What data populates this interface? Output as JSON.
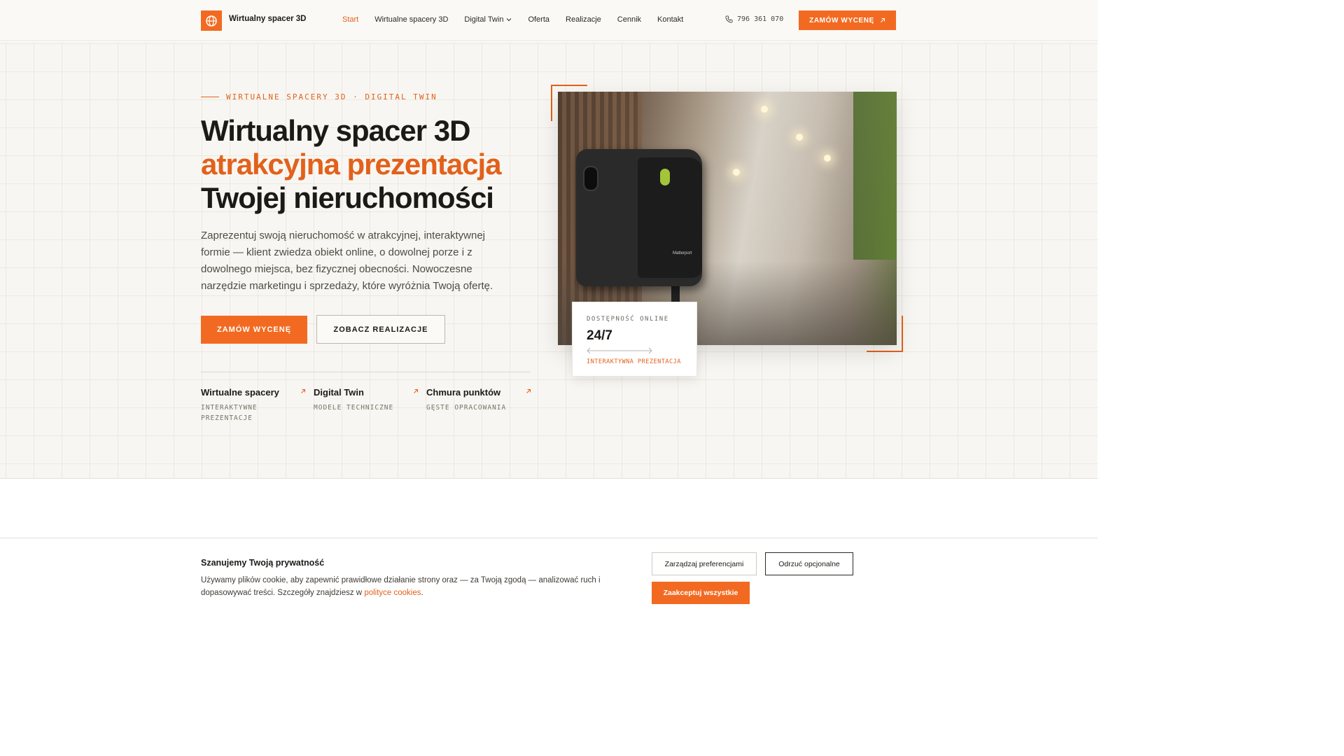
{
  "header": {
    "brand": "Wirtualny spacer 3D",
    "nav": [
      {
        "label": "Start",
        "active": true
      },
      {
        "label": "Wirtualne spacery 3D"
      },
      {
        "label": "Digital Twin",
        "dropdown": true
      },
      {
        "label": "Oferta"
      },
      {
        "label": "Realizacje"
      },
      {
        "label": "Cennik"
      },
      {
        "label": "Kontakt"
      }
    ],
    "phone": "796 361 070",
    "cta": "ZAMÓW WYCENĘ"
  },
  "hero": {
    "eyebrow": "WIRTUALNE SPACERY 3D · DIGITAL TWIN",
    "title_line1": "Wirtualny spacer 3D",
    "title_accent": "atrakcyjna prezentacja",
    "title_line3": "Twojej nieruchomości",
    "lead": "Zaprezentuj swoją nieruchomość w atrakcyjnej, interaktywnej formie — klient zwiedza obiekt online, o dowolnej porze i z dowolnego miejsca, bez fizycznej obecności. Nowoczesne narzędzie marketingu i sprzedaży, które wyróżnia Twoją ofertę.",
    "btn_primary": "ZAMÓW WYCENĘ",
    "btn_secondary": "ZOBACZ REALIZACJE",
    "features": [
      {
        "title": "Wirtualne spacery",
        "sub": "INTERAKTYWNE PREZENTACJE"
      },
      {
        "title": "Digital Twin",
        "sub": "MODELE TECHNICZNE"
      },
      {
        "title": "Chmura punktów",
        "sub": "GĘSTE OPRACOWANIA"
      }
    ],
    "photo_brand": "Matterport",
    "stat": {
      "label": "DOSTĘPNOŚĆ ONLINE",
      "value": "24/7",
      "caption": "INTERAKTYWNA PREZENTACJA"
    }
  },
  "cookie": {
    "title": "Szanujemy Twoją prywatność",
    "text": "Używamy plików cookie, aby zapewnić prawidłowe działanie strony oraz — za Twoją zgodą — analizować ruch i dopasowywać treści. Szczegóły znajdziesz w",
    "link": "polityce cookies",
    "text_end": ".",
    "manage": "Zarządzaj preferencjami",
    "reject": "Odrzuć opcjonalne",
    "accept": "Zaakceptuj wszystkie"
  },
  "colors": {
    "accent": "#f26a21",
    "text": "#1c1a17",
    "background": "#f8f6f2"
  },
  "icons": [
    "logo-globe-icon",
    "chevron-down-icon",
    "phone-icon",
    "arrow-up-right-icon",
    "double-arrow-icon"
  ]
}
